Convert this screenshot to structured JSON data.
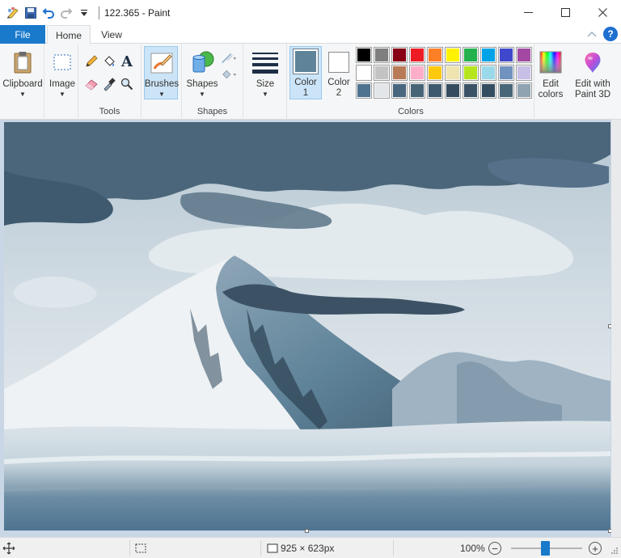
{
  "window": {
    "title": "122.365 - Paint"
  },
  "tabs": {
    "file": "File",
    "home": "Home",
    "view": "View"
  },
  "help_label": "?",
  "ribbon": {
    "clipboard": {
      "label": "Clipboard"
    },
    "image": {
      "label": "Image"
    },
    "tools": {
      "group_label": "Tools"
    },
    "brushes": {
      "label": "Brushes"
    },
    "shapes": {
      "label": "Shapes",
      "group_label": "Shapes"
    },
    "size": {
      "label": "Size"
    },
    "color1": {
      "line1": "Color",
      "line2": "1",
      "swatch": "#5f8399"
    },
    "color2": {
      "line1": "Color",
      "line2": "2",
      "swatch": "#ffffff"
    },
    "colors_group_label": "Colors",
    "edit_colors": {
      "line1": "Edit",
      "line2": "colors"
    },
    "paint3d": {
      "line1": "Edit with",
      "line2": "Paint 3D"
    }
  },
  "palette": {
    "row1": [
      "#000000",
      "#7f7f7f",
      "#880015",
      "#ed1c24",
      "#ff7f27",
      "#fff200",
      "#22b14c",
      "#00a2e8",
      "#3f48cc",
      "#a349a4"
    ],
    "row2": [
      "#ffffff",
      "#c3c3c3",
      "#b97a57",
      "#ffaec9",
      "#ffc90e",
      "#efe4b0",
      "#b5e61d",
      "#99d9ea",
      "#7092be",
      "#c8bfe7"
    ],
    "row3": [
      "#4e7391",
      "#e3e6e8",
      "#48667d",
      "#486477",
      "#3e5a6e",
      "#354c5f",
      "#3a5266",
      "#354d60",
      "#486778",
      "#8fa3b1"
    ]
  },
  "status": {
    "dimensions": "925 × 623px",
    "zoom": "100%",
    "zoom_level_percent": 100
  }
}
